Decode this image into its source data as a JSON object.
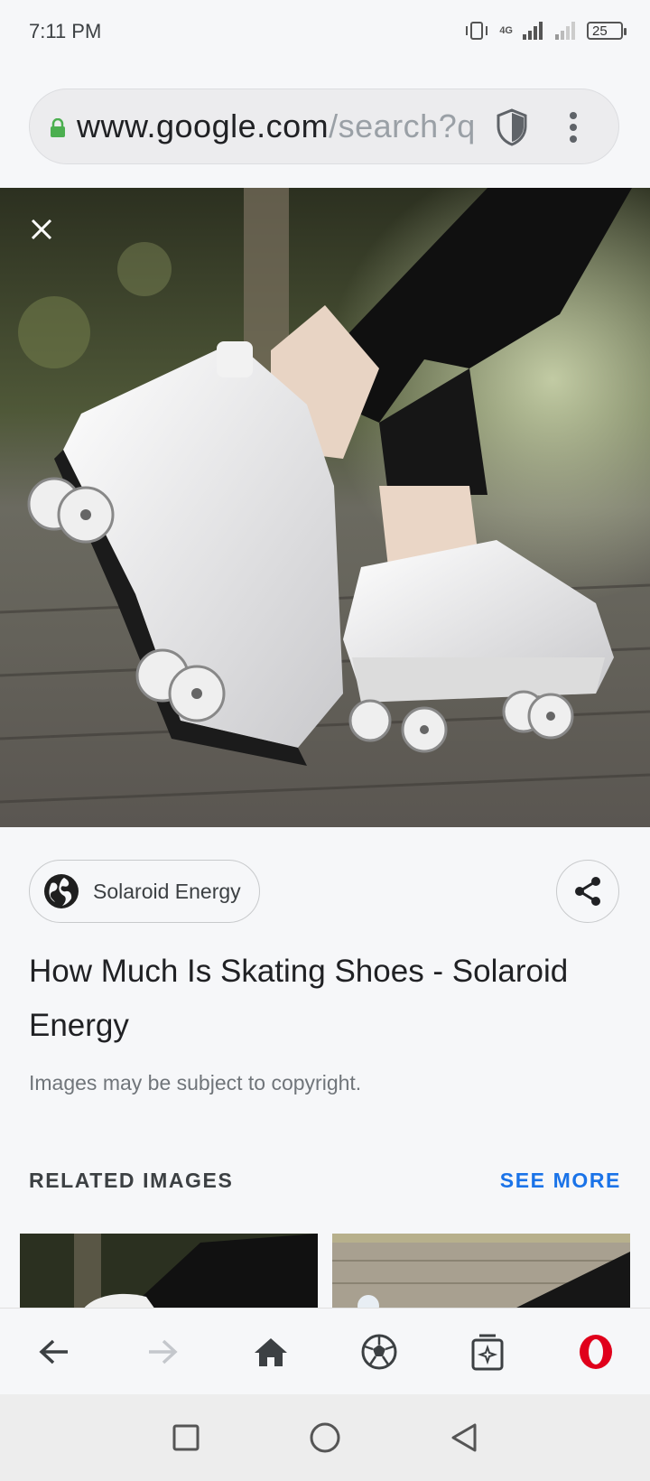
{
  "status_bar": {
    "time": "7:11 PM",
    "network": "4G",
    "battery": "25"
  },
  "browser": {
    "url_host": "www.google.com",
    "url_path": "/search?q"
  },
  "viewer": {
    "source_name": "Solaroid Energy",
    "title": "How Much Is Skating Shoes - Solaroid Energy",
    "copyright_note": "Images may be subject to copyright.",
    "related_heading": "RELATED IMAGES",
    "see_more_label": "SEE MORE"
  },
  "colors": {
    "accent_blue": "#1a73e8",
    "lock_green": "#4caf50",
    "opera_red": "#e0001b"
  },
  "icons": [
    "lock-icon",
    "shield-icon",
    "menu-icon",
    "close-icon",
    "globe-icon",
    "share-icon",
    "back-icon",
    "forward-icon",
    "home-icon",
    "soccer-ball-icon",
    "tabs-icon",
    "opera-icon",
    "square-icon",
    "circle-icon",
    "triangle-back-icon"
  ]
}
